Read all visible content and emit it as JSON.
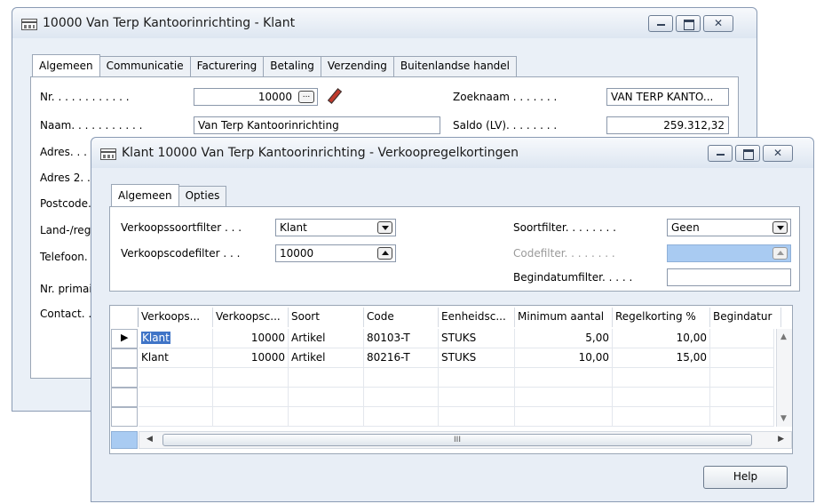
{
  "back_window": {
    "title": "10000 Van Terp Kantoorinrichting - Klant",
    "tabs": [
      "Algemeen",
      "Communicatie",
      "Facturering",
      "Betaling",
      "Verzending",
      "Buitenlandse handel"
    ],
    "labels": {
      "nr": "Nr. . . . . . . . . . . .",
      "naam": "Naam. . . . . . . . . . .",
      "adres": "Adres. . . . . .",
      "adres2": "Adres 2. . . .",
      "postcode": "Postcode. . .",
      "land": "Land-/regio",
      "telefoon": "Telefoon. . .",
      "nr_primair": "Nr. primair",
      "contact": "Contact. . . .",
      "zoeknaam": "Zoeknaam . . . . . . .",
      "saldo": "Saldo (LV). . . . . . . ."
    },
    "values": {
      "nr": "10000",
      "naam": "Van Terp Kantoorinrichting",
      "zoeknaam": "VAN TERP KANTO...",
      "saldo": "259.312,32"
    },
    "icons": {
      "ellipsis": "ellipsis-button",
      "pencil": "pencil-icon"
    }
  },
  "front_window": {
    "title": "Klant 10000 Van Terp Kantoorinrichting   - Verkoopregelkortingen",
    "tabs": [
      "Algemeen",
      "Opties"
    ],
    "filters": {
      "verkoopssoortfilter_label": "Verkoopssoortfilter . . .",
      "verkoopssoortfilter_value": "Klant",
      "verkoopscodefilter_label": "Verkoopscodefilter . . .",
      "verkoopscodefilter_value": "10000",
      "soortfilter_label": "Soortfilter. . . . . . . .",
      "soortfilter_value": "Geen",
      "codefilter_label": "Codefilter. . . . . . . .",
      "codefilter_value": "",
      "begindatumfilter_label": "Begindatumfilter. . . . .",
      "begindatumfilter_value": ""
    },
    "grid": {
      "columns": [
        "Verkoops...",
        "Verkoopsc...",
        "Soort",
        "Code",
        "Eenheidsc...",
        "Minimum aantal",
        "Regelkorting %",
        "Begindatur"
      ],
      "rows": [
        [
          "Klant",
          "10000",
          "Artikel",
          "80103-T",
          "STUKS",
          "5,00",
          "10,00",
          ""
        ],
        [
          "Klant",
          "10000",
          "Artikel",
          "80216-T",
          "STUKS",
          "10,00",
          "15,00",
          ""
        ]
      ],
      "scroll_thumb_glyph": "III"
    },
    "help_button": "Help"
  }
}
